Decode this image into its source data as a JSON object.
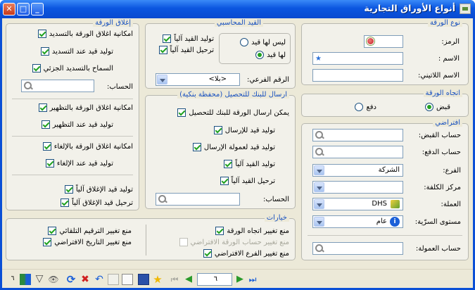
{
  "window": {
    "title": "أنواع الأوراق التجارية"
  },
  "doc_type": {
    "title": "نوع الورقة",
    "code_label": "الرمز:",
    "name_label": "الاسم :",
    "latin_label": "الاسم اللاتيني:"
  },
  "accounting": {
    "title": "القيد المحاسبي",
    "no_entry": "ليس لها قيد",
    "has_entry": "لها قيد",
    "auto_gen": "توليد القيد آلياً",
    "auto_post": "ترحيل القيد آلياً",
    "branch_no_label": "الرقم الفرعي:",
    "branch_no_value": "<بلا>"
  },
  "closing": {
    "title": "إغلاق الورقة",
    "allow_close_pay": "امكانية اغلاق الورقة بالتسديد",
    "gen_on_pay": "توليد قيد عند التسديد",
    "allow_partial": "السماح بالتسديد الجزئي",
    "account_label": "الحساب:",
    "allow_close_endorse": "امكانية اغلاق الورقة بالتظهير",
    "gen_on_endorse": "توليد قيد عند التظهير",
    "allow_close_cancel": "امكانية اغلاق الورقة بالإلغاء",
    "gen_on_cancel": "توليد قيد عند الإلغاء",
    "gen_close_auto": "توليد قيد الإغلاق آلياً",
    "post_close_auto": "ترحيل قيد الإغلاق آلياً"
  },
  "direction": {
    "title": "اتجاه الورقة",
    "receive": "قبض",
    "pay": "دفع"
  },
  "bank": {
    "title": "ارسال للبنك للتحصيل (محفظة بنكية)",
    "can_send": "يمكن ارسال الورقة للبنك للتحصيل",
    "gen_send": "توليد قيد للإرسال",
    "gen_commission": "توليد قيد لعمولة الإرسال",
    "gen_auto": "توليد القيد آلياً",
    "post_auto": "ترحيل القيد آلياً",
    "account_label": "الحساب:"
  },
  "defaults": {
    "title": "افتراضي",
    "receive_acc": "حساب القبض:",
    "pay_acc": "حساب الدفع:",
    "branch_label": "الفرع:",
    "branch_value": "الشركة",
    "cost_center": "مركز الكلفة:",
    "currency_label": "العملة:",
    "currency_value": "DHS",
    "security_label": "مستوى السرّية:",
    "security_value": "عام",
    "commission_acc": "حساب العمولة:"
  },
  "options": {
    "title": "خيارات",
    "no_change_direction": "منع تغيير اتجاه الورقة",
    "no_change_default_acc": "منع تغيير حساب الورقة الافتراضي",
    "no_change_default_branch": "منع تغيير الفرع الافتراضي",
    "no_change_auto_number": "منع تغيير الترقيم التلقائي",
    "no_change_default_date": "منع تغيير التاريخ الافتراضي"
  },
  "toolbar": {
    "record_number": "٦",
    "count": "٦"
  }
}
